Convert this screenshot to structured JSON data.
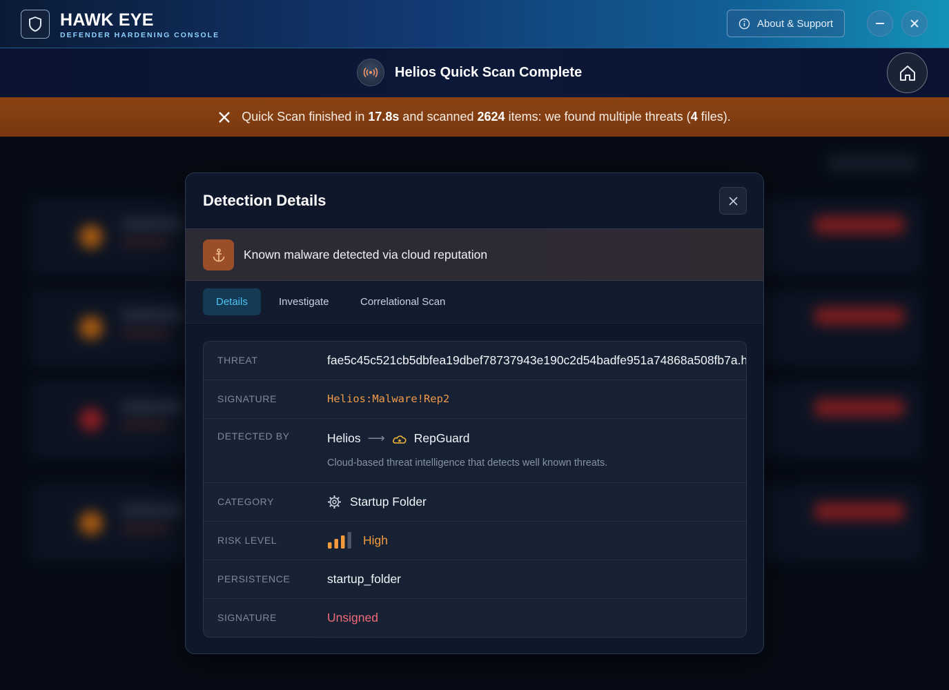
{
  "app": {
    "title": "HAWK EYE",
    "subtitle": "DEFENDER HARDENING CONSOLE",
    "about_label": "About & Support"
  },
  "header": {
    "title": "Helios Quick Scan Complete"
  },
  "banner": {
    "prefix": "Quick Scan finished in ",
    "duration": "17.8s",
    "mid1": " and scanned ",
    "items": "2624",
    "mid2": " items: we found multiple threats (",
    "files": "4",
    "suffix": " files)."
  },
  "modal": {
    "title": "Detection Details",
    "detection_summary": "Known malware detected via cloud reputation",
    "tabs": [
      "Details",
      "Investigate",
      "Correlational Scan"
    ],
    "active_tab": "Details",
    "rows": {
      "threat": {
        "label": "THREAT",
        "value": "fae5c45c521cb5dbfea19dbef78737943e190c2d54badfe951a74868a508fb7a.h"
      },
      "signature": {
        "label": "SIGNATURE",
        "value": "Helios:Malware!Rep2"
      },
      "detected_by": {
        "label": "DETECTED BY",
        "engine": "Helios",
        "arrow": "⟶",
        "module": "RepGuard",
        "description": "Cloud-based threat intelligence that detects well known threats."
      },
      "category": {
        "label": "CATEGORY",
        "value": "Startup Folder"
      },
      "risk": {
        "label": "RISK LEVEL",
        "value": "High",
        "level": 3,
        "max": 4
      },
      "persistence": {
        "label": "PERSISTENCE",
        "value": "startup_folder"
      },
      "signing": {
        "label": "SIGNATURE",
        "value": "Unsigned"
      }
    }
  },
  "colors": {
    "accent": "#4fc3f0",
    "banner": "#7a3810",
    "risk_high": "#f39a3c",
    "unsigned": "#f06a7a",
    "anchor_bg": "#9a4f2a"
  },
  "icons": {
    "logo": "shield-icon",
    "about": "info-icon",
    "minimize": "minus-icon",
    "close": "close-icon",
    "scan": "radar-broadcast-icon",
    "home": "home-icon",
    "banner": "x-icon",
    "detection": "anchor-icon",
    "module": "cloud-star-icon",
    "category": "gear-icon",
    "risk": "signal-bars-icon"
  }
}
